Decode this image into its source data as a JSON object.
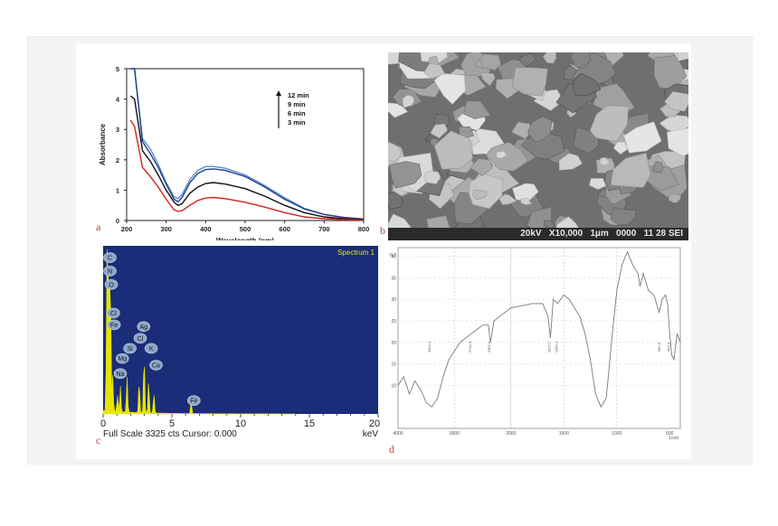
{
  "figure": {
    "panel_labels": [
      "a",
      "b",
      "c",
      "d"
    ]
  },
  "colors": {
    "eds_background": "#1b2c78",
    "eds_spectrum": "#e6e600",
    "eds_title": "#e6e600",
    "uv_12min": "#5a8fc8",
    "uv_9min": "#1f3f8f",
    "uv_6min": "#111111",
    "uv_3min": "#d42020",
    "ir_line": "#7a7a7a",
    "sem_fill": "#9c9c9c"
  },
  "sem": {
    "info_bar": "20kV   X10,000   1µm   0000   11 28 SEI"
  },
  "eds": {
    "title": "Spectrum 1",
    "footer_left": "Full Scale 3325 cts Cursor: 0.000",
    "footer_right": "keV"
  },
  "chart_data": [
    {
      "type": "line",
      "panel": "a",
      "xlabel": "Wavelength (nm)",
      "ylabel": "Absorbance",
      "xlim": [
        200,
        800
      ],
      "ylim": [
        0,
        5
      ],
      "xticks": [
        200,
        300,
        400,
        500,
        600,
        700,
        800
      ],
      "yticks": [
        0,
        1,
        2,
        3,
        4,
        5
      ],
      "legend": [
        "12 min",
        "9 min",
        "6 min",
        "3 min"
      ],
      "legend_placement": "top-right",
      "arrow": "up",
      "x": [
        210,
        220,
        240,
        260,
        280,
        300,
        320,
        330,
        340,
        360,
        380,
        400,
        420,
        450,
        500,
        550,
        600,
        650,
        700,
        750,
        800
      ],
      "series": [
        {
          "name": "12 min",
          "values": [
            5.0,
            5.0,
            2.7,
            2.35,
            1.85,
            1.25,
            0.78,
            0.72,
            0.85,
            1.35,
            1.65,
            1.78,
            1.78,
            1.72,
            1.5,
            1.15,
            0.75,
            0.4,
            0.2,
            0.1,
            0.05
          ]
        },
        {
          "name": "9 min",
          "values": [
            5.0,
            5.0,
            2.6,
            2.2,
            1.75,
            1.2,
            0.7,
            0.62,
            0.75,
            1.25,
            1.55,
            1.68,
            1.7,
            1.65,
            1.45,
            1.1,
            0.7,
            0.38,
            0.2,
            0.1,
            0.05
          ]
        },
        {
          "name": "6 min",
          "values": [
            4.1,
            4.0,
            2.3,
            1.95,
            1.5,
            1.0,
            0.6,
            0.5,
            0.55,
            0.9,
            1.1,
            1.22,
            1.25,
            1.2,
            1.05,
            0.8,
            0.5,
            0.26,
            0.12,
            0.06,
            0.03
          ]
        },
        {
          "name": "3 min",
          "values": [
            3.3,
            3.1,
            1.75,
            1.45,
            1.1,
            0.7,
            0.35,
            0.3,
            0.32,
            0.5,
            0.66,
            0.74,
            0.76,
            0.72,
            0.6,
            0.44,
            0.26,
            0.12,
            0.06,
            0.03,
            0.02
          ]
        }
      ]
    },
    {
      "type": "area",
      "panel": "c",
      "title": "Spectrum 1",
      "xlabel": "keV",
      "xlim": [
        0,
        20
      ],
      "xticks": [
        0,
        5,
        10,
        15,
        20
      ],
      "full_scale_counts": 3325,
      "peaks": [
        {
          "label": "C",
          "kev": 0.28,
          "height": 0.95
        },
        {
          "label": "N",
          "kev": 0.39,
          "height": 0.92
        },
        {
          "label": "O",
          "kev": 0.52,
          "height": 0.9
        },
        {
          "label": "Fe",
          "kev": 0.7,
          "height": 0.22
        },
        {
          "label": "Na",
          "kev": 1.04,
          "height": 0.1
        },
        {
          "label": "Mg",
          "kev": 1.25,
          "height": 0.16
        },
        {
          "label": "Si",
          "kev": 1.74,
          "height": 0.22
        },
        {
          "label": "Ag",
          "kev": 2.98,
          "height": 0.36
        },
        {
          "label": "Cl",
          "kev": 2.62,
          "height": 0.2
        },
        {
          "label": "K",
          "kev": 3.31,
          "height": 0.2
        },
        {
          "label": "Ca",
          "kev": 3.69,
          "height": 0.12
        },
        {
          "label": "Fe",
          "kev": 6.4,
          "height": 0.07
        }
      ],
      "bubble_labels": [
        "C",
        "N",
        "O",
        "Cl",
        "Fe",
        "Ag",
        "Cl",
        "Mg",
        "Si",
        "K",
        "Na",
        "Ca",
        "Fe"
      ]
    },
    {
      "type": "line",
      "panel": "d",
      "ylabel": "%T",
      "xlabel": "1/cm",
      "xlim": [
        4000,
        400
      ],
      "ylim": [
        0,
        42
      ],
      "xticks": [
        4000,
        3000,
        2000,
        1500,
        1000,
        500
      ],
      "yticks": [
        10,
        15,
        20,
        25,
        30,
        35,
        40
      ],
      "x": [
        4000,
        3900,
        3800,
        3700,
        3600,
        3500,
        3400,
        3300,
        3200,
        3100,
        3000,
        2900,
        2800,
        2700,
        2600,
        2500,
        2400,
        2362,
        2300,
        2200,
        2100,
        2000,
        1900,
        1800,
        1700,
        1650,
        1627,
        1600,
        1560,
        1500,
        1450,
        1400,
        1350,
        1300,
        1250,
        1200,
        1150,
        1100,
        1080,
        1050,
        1000,
        950,
        900,
        850,
        800,
        780,
        750,
        700,
        650,
        600,
        570,
        540,
        520,
        500,
        480,
        460,
        430,
        400
      ],
      "values": [
        10,
        12,
        8,
        11,
        9,
        6,
        5,
        7,
        12,
        16,
        18,
        20,
        21,
        22,
        23,
        24,
        24,
        20,
        25,
        26,
        27,
        28,
        28.5,
        29,
        29,
        26,
        21,
        30,
        29,
        31,
        30,
        28,
        26,
        22,
        16,
        8,
        5,
        7,
        12,
        20,
        32,
        38,
        41,
        38,
        36,
        33,
        36,
        32,
        31,
        27,
        30,
        31,
        29,
        22,
        17,
        16,
        22,
        20
      ],
      "peak_labels": [
        {
          "x": 3424,
          "text": "3424.3"
        },
        {
          "x": 2700,
          "text": "2744.0"
        },
        {
          "x": 2362,
          "text": "2362.9"
        },
        {
          "x": 1627,
          "text": "1627.7"
        },
        {
          "x": 1560,
          "text": "1560.3"
        },
        {
          "x": 587,
          "text": "587.6"
        },
        {
          "x": 497,
          "text": "497.8"
        }
      ]
    }
  ]
}
